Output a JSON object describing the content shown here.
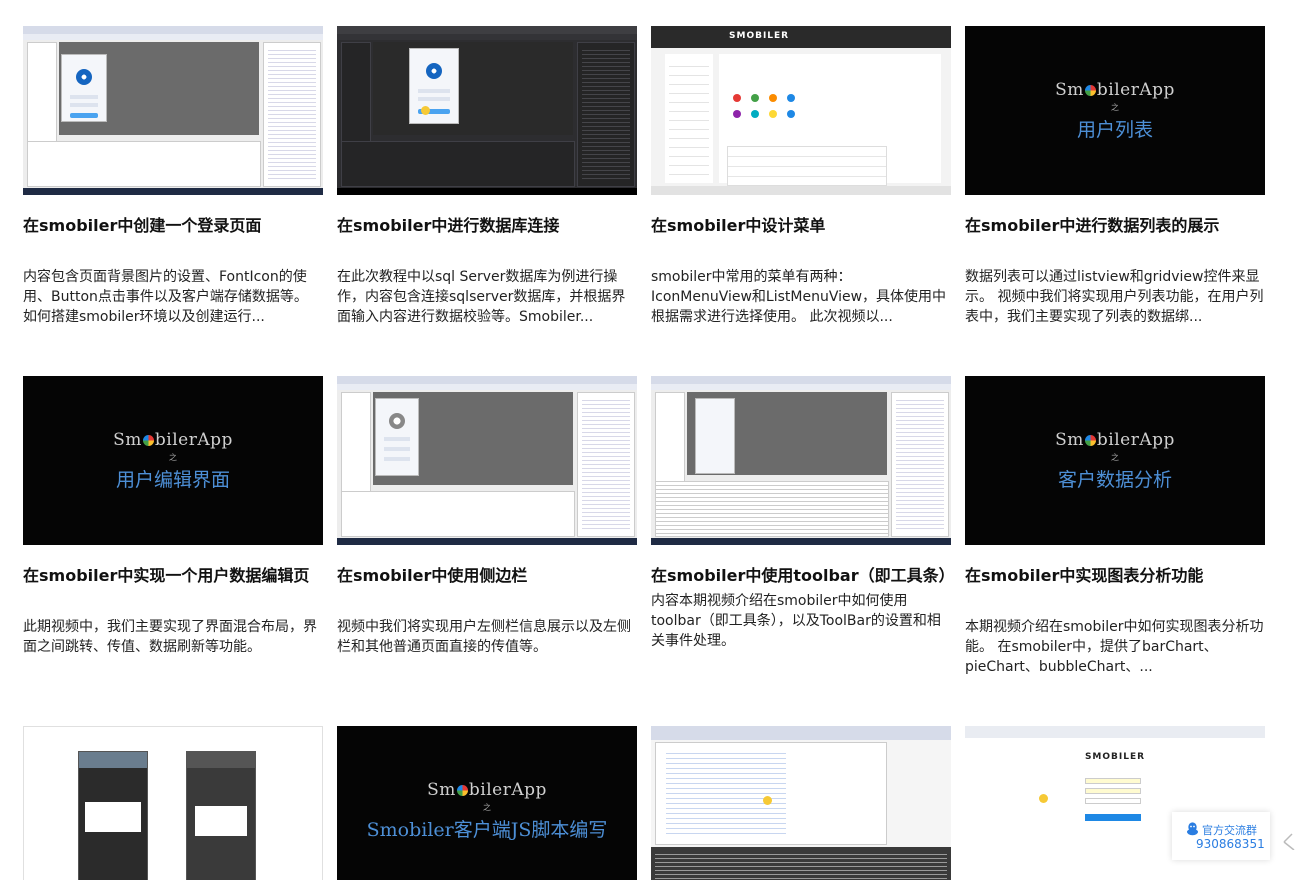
{
  "cards": [
    {
      "title": "在smobiler中创建一个登录页面",
      "desc": "内容包含页面背景图片的设置、FontIcon的使用、Button点击事件以及客户端存储数据等。 如何搭建smobiler环境以及创建运行..."
    },
    {
      "title": "在smobiler中进行数据库连接",
      "desc": "在此次教程中以sql Server数据库为例进行操作，内容包含连接sqlserver数据库，并根据界面输入内容进行数据校验等。Smobiler..."
    },
    {
      "title": "在smobiler中设计菜单",
      "desc": "smobiler中常用的菜单有两种：IconMenuView和ListMenuView，具体使用中根据需求进行选择使用。 此次视频以..."
    },
    {
      "title": "在smobiler中进行数据列表的展示",
      "desc": "数据列表可以通过listview和gridview控件来显示。 视频中我们将实现用户列表功能，在用户列表中，我们主要实现了列表的数据绑..."
    },
    {
      "title": "在smobiler中实现一个用户数据编辑页",
      "desc": "此期视频中，我们主要实现了界面混合布局，界面之间跳转、传值、数据刷新等功能。"
    },
    {
      "title": "在smobiler中使用侧边栏",
      "desc": "视频中我们将实现用户左侧栏信息展示以及左侧栏和其他普通页面直接的传值等。"
    },
    {
      "title": "在smobiler中使用toolbar（即工具条）",
      "desc": "内容本期视频介绍在smobiler中如何使用toolbar（即工具条），以及ToolBar的设置和相关事件处理。"
    },
    {
      "title": "在smobiler中实现图表分析功能",
      "desc": "本期视频介绍在smobiler中如何实现图表分析功能。 在smobiler中，提供了barChart、pieChart、bubbleChart、..."
    },
    {
      "title": "",
      "desc": ""
    },
    {
      "title": "",
      "desc": ""
    },
    {
      "title": "",
      "desc": ""
    },
    {
      "title": "",
      "desc": ""
    }
  ],
  "thumbs": {
    "list_brand": "SmobilerApp",
    "list_zhi": "之",
    "list_sub": "用户列表",
    "edit_brand": "SmobilerApp",
    "edit_zhi": "之",
    "edit_sub": "用户编辑界面",
    "analysis_brand": "SmobilerApp",
    "analysis_zhi": "之",
    "analysis_sub": "客户数据分析",
    "js_brand": "SmobilerApp",
    "js_zhi": "之",
    "js_sub": "Smobiler客户端JS脚本编写",
    "menu_wordmark": "SMOBILER",
    "login_wordmark": "SMOBILER"
  },
  "qq_widget": {
    "label": "官方交流群",
    "number": "930868351",
    "icon": "qq-icon"
  },
  "colors": {
    "subtitle_blue": "#4d8fd6",
    "qq_blue": "#2a7de1"
  }
}
